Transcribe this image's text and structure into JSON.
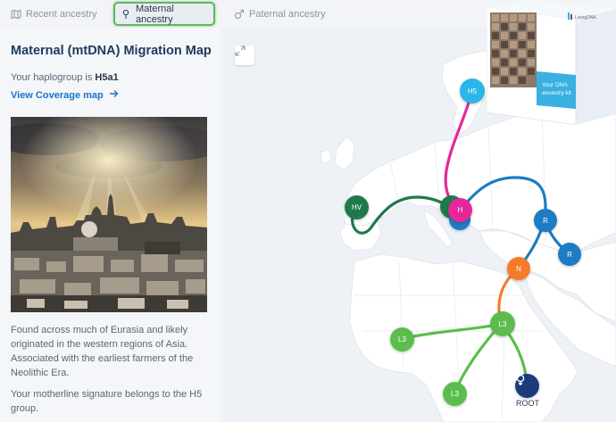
{
  "tabs": [
    {
      "label": "Recent ancestry",
      "icon": "map-icon"
    },
    {
      "label": "Maternal ancestry",
      "icon": "pin-icon"
    },
    {
      "label": "Paternal ancestry",
      "icon": "male-symbol-icon"
    }
  ],
  "panel": {
    "title": "Maternal (mtDNA) Migration Map",
    "haplogroup_prefix": "Your haplogroup is ",
    "haplogroup": "H5a1",
    "coverage_link": "View Coverage map",
    "description": "Found across much of Eurasia and likely originated in the western regions of Asia. Associated with the earliest farmers of the Neolithic Era.",
    "signature": "Your motherline signature belongs to the H5 group."
  },
  "map": {
    "nodes": {
      "h5": "H5",
      "hv": "HV",
      "h": "H",
      "r1": "R",
      "r2": "R",
      "n": "N",
      "l3a": "L3",
      "l3b": "L3",
      "l3c": "L3",
      "root": "ROOT"
    }
  },
  "kit": {
    "brand": "LivingDNA",
    "line1": "Your DNA",
    "line2": "ancestry kit"
  },
  "colors": {
    "pink": "#e6279a",
    "light_blue": "#29b6e8",
    "dark_green": "#1f7a4a",
    "blue": "#1c7cc4",
    "orange": "#f47b2a",
    "light_green": "#5cbd4e",
    "navy": "#1f3a7a"
  }
}
